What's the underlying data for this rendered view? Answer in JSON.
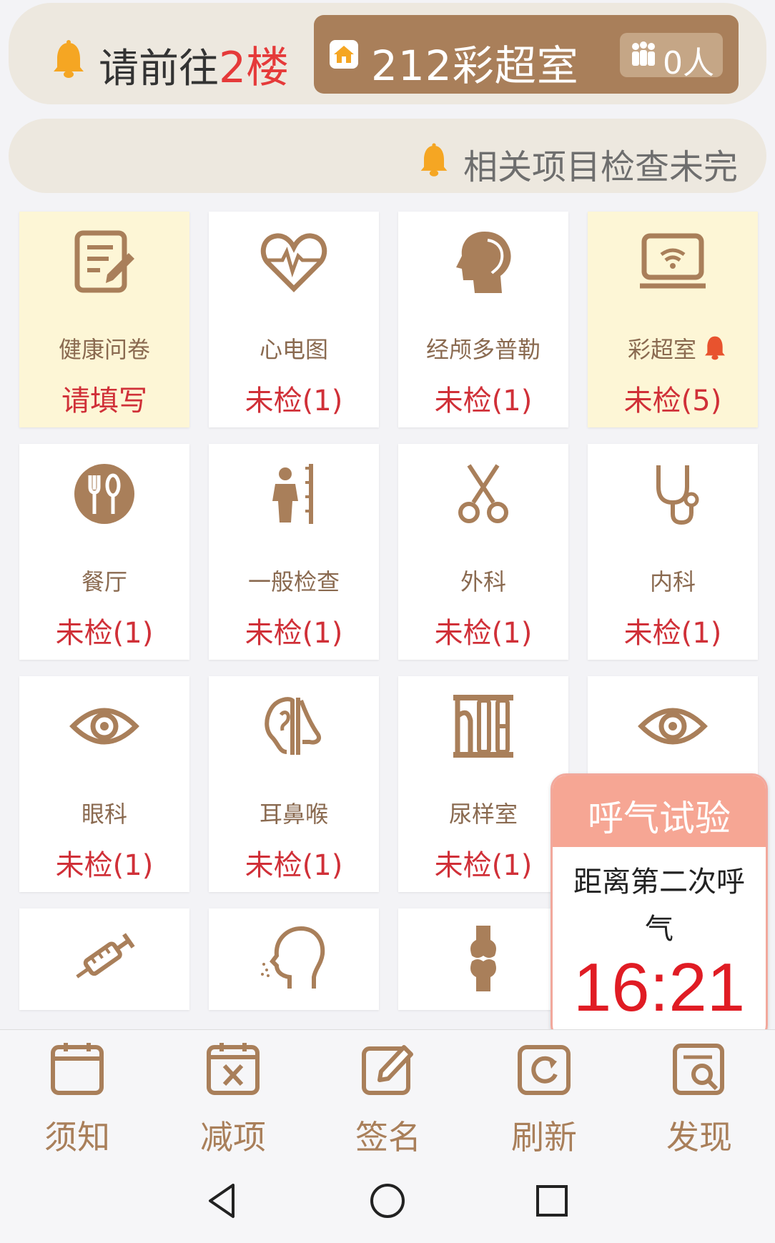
{
  "top_banner": {
    "prefix": "请前往",
    "floor": "2楼",
    "room_name": "212彩超室",
    "people_count": "0人"
  },
  "notice": {
    "text": "相关项目检查未完"
  },
  "tiles": [
    {
      "name": "健康问卷",
      "status": "请填写",
      "icon": "questionnaire-icon",
      "highlighted": true
    },
    {
      "name": "心电图",
      "status": "未检(1)",
      "icon": "heart-ecg-icon",
      "highlighted": false
    },
    {
      "name": "经颅多普勒",
      "status": "未检(1)",
      "icon": "head-brain-icon",
      "highlighted": false
    },
    {
      "name": "彩超室",
      "status": "未检(5)",
      "icon": "ultrasound-icon",
      "highlighted": true
    },
    {
      "name": "餐厅",
      "status": "未检(1)",
      "icon": "dining-icon",
      "highlighted": false
    },
    {
      "name": "一般检查",
      "status": "未检(1)",
      "icon": "height-measure-icon",
      "highlighted": false
    },
    {
      "name": "外科",
      "status": "未检(1)",
      "icon": "scissors-icon",
      "highlighted": false
    },
    {
      "name": "内科",
      "status": "未检(1)",
      "icon": "stethoscope-icon",
      "highlighted": false
    },
    {
      "name": "眼科",
      "status": "未检(1)",
      "icon": "eye-icon",
      "highlighted": false
    },
    {
      "name": "耳鼻喉",
      "status": "未检(1)",
      "icon": "ear-nose-icon",
      "highlighted": false
    },
    {
      "name": "尿样室",
      "status": "未检(1)",
      "icon": "urine-icon",
      "highlighted": false
    },
    {
      "name": "",
      "status": "",
      "icon": "eye-icon",
      "highlighted": false
    },
    {
      "name": "",
      "status": "",
      "icon": "syringe-icon",
      "highlighted": false
    },
    {
      "name": "",
      "status": "",
      "icon": "head-breath-icon",
      "highlighted": false
    },
    {
      "name": "",
      "status": "",
      "icon": "knee-joint-icon",
      "highlighted": false
    }
  ],
  "breath_test": {
    "title": "呼气试验",
    "message": "距离第二次呼气",
    "countdown": "16:21"
  },
  "bottom_bar": [
    {
      "label": "须知",
      "icon": "calendar-icon"
    },
    {
      "label": "减项",
      "icon": "calendar-x-icon"
    },
    {
      "label": "签名",
      "icon": "edit-icon"
    },
    {
      "label": "刷新",
      "icon": "refresh-icon"
    },
    {
      "label": "发现",
      "icon": "search-doc-icon"
    }
  ],
  "colors": {
    "brand_brown": "#a97f5a",
    "status_red": "#d03038",
    "highlight_yellow": "#fdf6d6",
    "banner_bg": "#ede8df",
    "bell_orange": "#f5a623"
  }
}
